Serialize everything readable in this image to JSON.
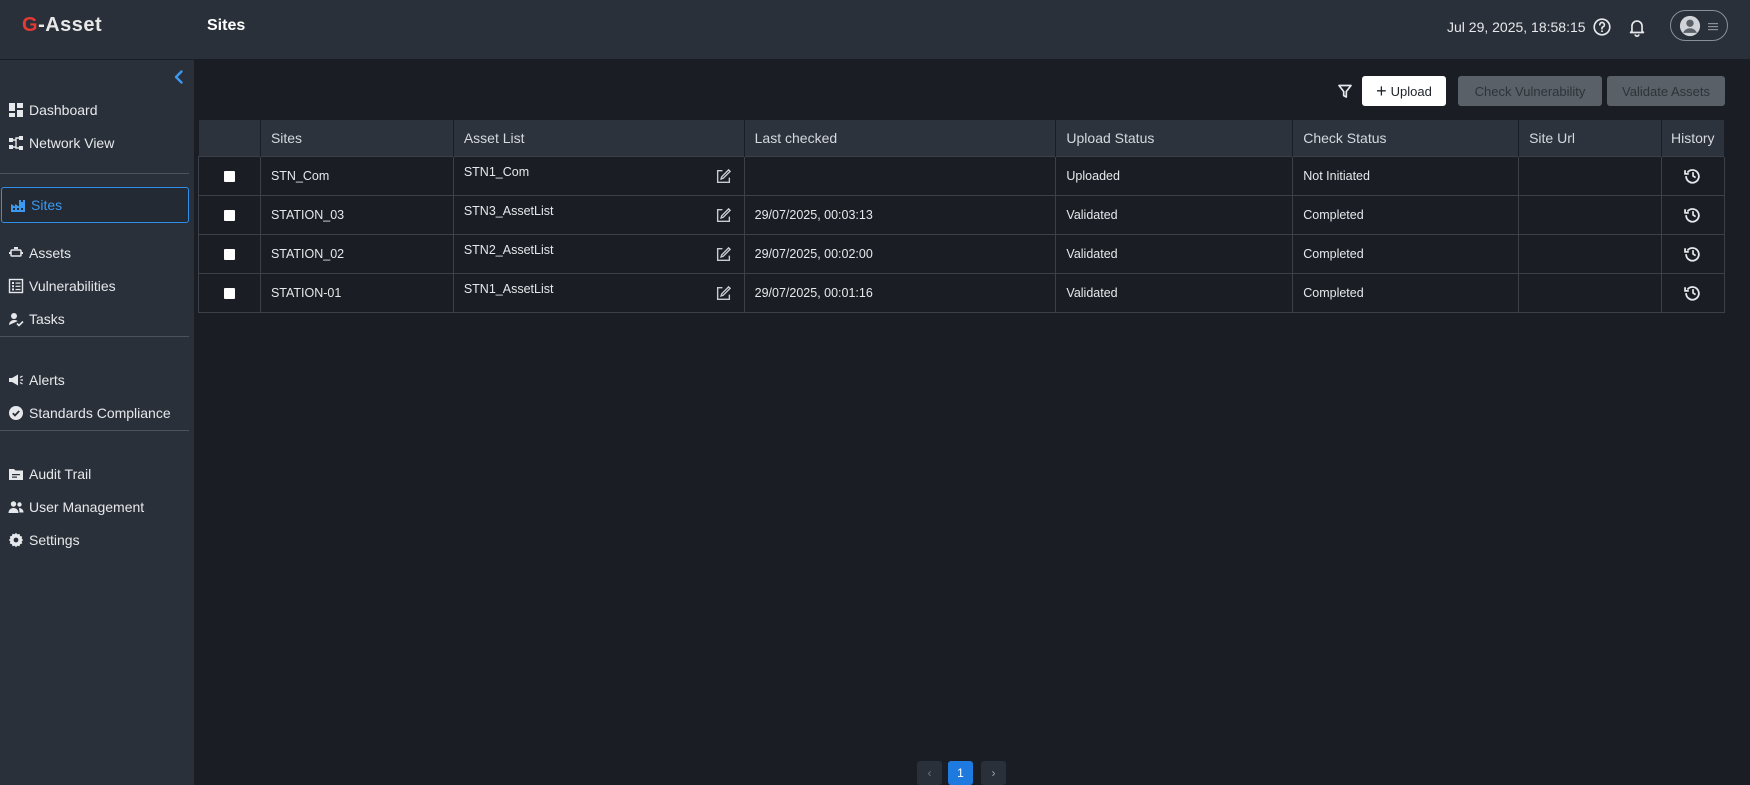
{
  "app": {
    "logo_g": "G",
    "logo_rest": "-Asset",
    "page_title": "Sites",
    "datetime": "Jul 29, 2025, 18:58:15"
  },
  "sidebar": {
    "items": [
      {
        "label": "Dashboard",
        "icon": "dashboard-icon"
      },
      {
        "label": "Network View",
        "icon": "network-icon"
      },
      {
        "label": "Sites",
        "icon": "factory-icon",
        "active": true
      },
      {
        "label": "Assets",
        "icon": "asset-icon"
      },
      {
        "label": "Vulnerabilities",
        "icon": "list-icon"
      },
      {
        "label": "Tasks",
        "icon": "tasks-icon"
      },
      {
        "label": "Alerts",
        "icon": "megaphone-icon"
      },
      {
        "label": "Standards Compliance",
        "icon": "badge-check-icon"
      },
      {
        "label": "Audit Trail",
        "icon": "folder-icon"
      },
      {
        "label": "User Management",
        "icon": "users-icon"
      },
      {
        "label": "Settings",
        "icon": "gear-icon"
      }
    ]
  },
  "toolbar": {
    "upload_label": "Upload",
    "upload_plus": "+",
    "check_vulnerability_label": "Check Vulnerability",
    "validate_assets_label": "Validate Assets"
  },
  "table": {
    "headers": [
      "",
      "Sites",
      "Asset List",
      "Last checked",
      "Upload Status",
      "Check Status",
      "Site Url",
      "History"
    ],
    "rows": [
      {
        "site": "STN_Com",
        "asset_list": "STN1_Com",
        "last_checked": "",
        "upload_status": "Uploaded",
        "upload_color": "red",
        "check_status": "Not Initiated",
        "check_color": "blue",
        "site_url": ""
      },
      {
        "site": "STATION_03",
        "asset_list": "STN3_AssetList",
        "last_checked": "29/07/2025, 00:03:13",
        "upload_status": "Validated",
        "upload_color": "green",
        "check_status": "Completed",
        "check_color": "green",
        "site_url": ""
      },
      {
        "site": "STATION_02",
        "asset_list": "STN2_AssetList",
        "last_checked": "29/07/2025, 00:02:00",
        "upload_status": "Validated",
        "upload_color": "green",
        "check_status": "Completed",
        "check_color": "green",
        "site_url": ""
      },
      {
        "site": "STATION-01",
        "asset_list": "STN1_AssetList",
        "last_checked": "29/07/2025, 00:01:16",
        "upload_status": "Validated",
        "upload_color": "green",
        "check_status": "Completed",
        "check_color": "green",
        "site_url": ""
      }
    ]
  },
  "pagination": {
    "prev": "‹",
    "current": "1",
    "next": "›"
  },
  "colors": {
    "accent": "#1f7ae0",
    "status_red": "#e5302e",
    "status_green": "#3cae4a",
    "status_blue": "#3b8fe8"
  }
}
